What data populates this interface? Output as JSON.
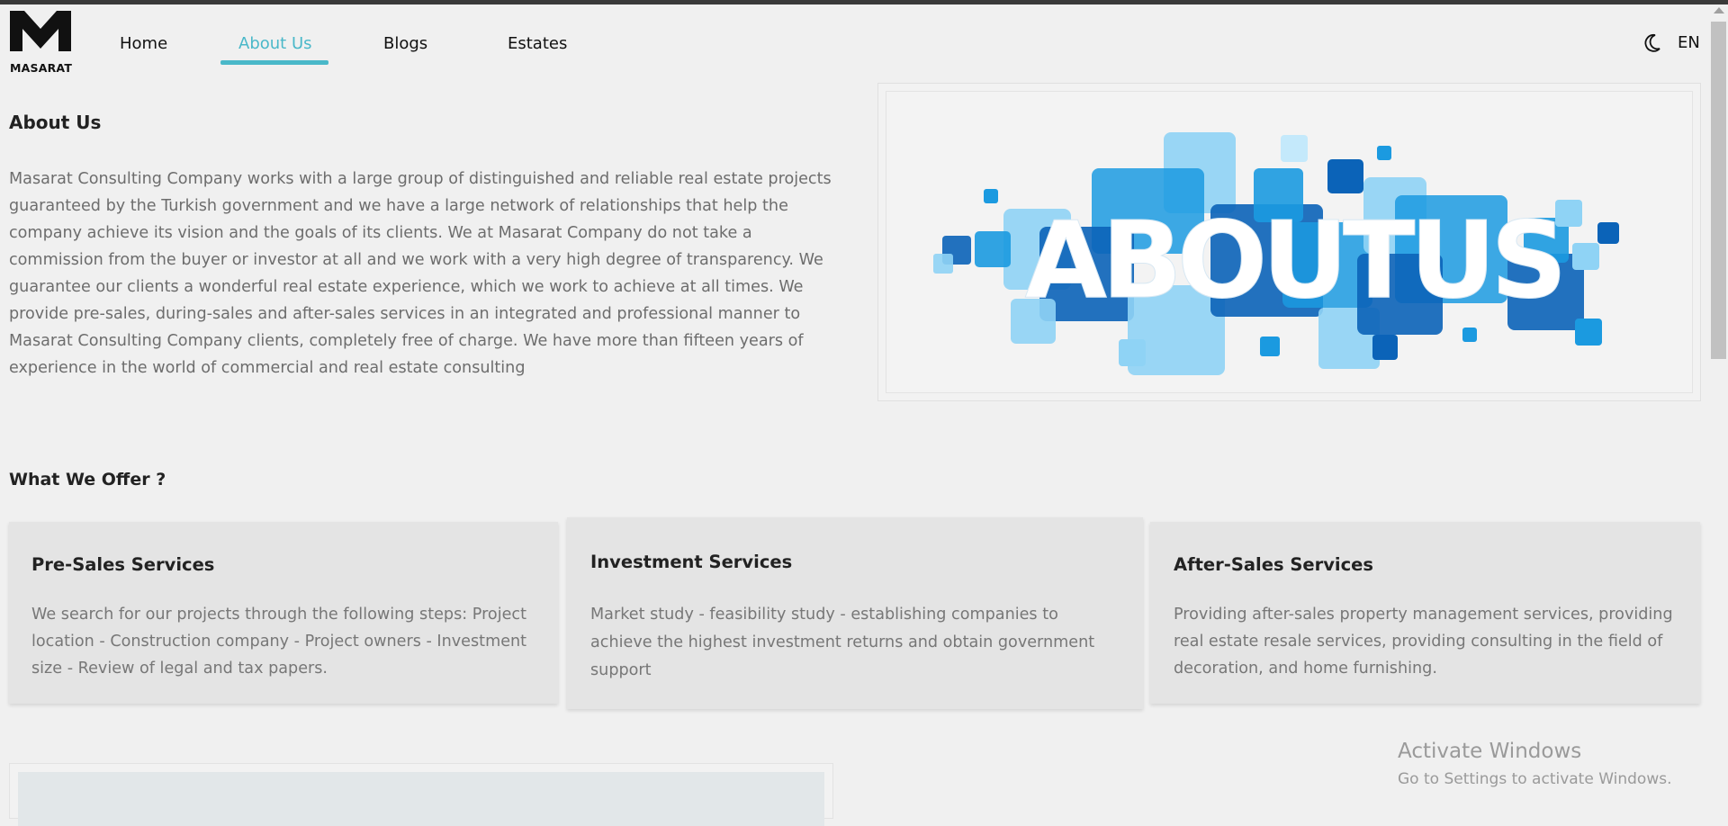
{
  "brand": {
    "logo_text": "MASARAT"
  },
  "nav": {
    "items": [
      {
        "label": "Home"
      },
      {
        "label": "About Us",
        "active": true
      },
      {
        "label": "Blogs"
      },
      {
        "label": "Estates"
      }
    ],
    "theme_toggle_icon": "moon-icon",
    "language": "EN"
  },
  "colors": {
    "accent": "#4ab8c9",
    "background": "#f0f0f0",
    "card": "#e4e4e4"
  },
  "about": {
    "title": "About Us",
    "text": "Masarat Consulting Company works with a large group of distinguished and reliable real estate projects guaranteed by the Turkish government and we have a large network of relationships that help the company achieve its vision and the goals of its clients. We at Masarat Company do not take a commission from the buyer or investor at all and we work with a very high degree of transparency. We guarantee our clients a wonderful real estate experience, which we work to achieve at all times. We provide pre-sales, during-sales and after-sales services in an integrated and professional manner to Masarat Consulting Company clients, completely free of charge. We have more than fifteen years of experience in the world of commercial and real estate consulting",
    "image_text": "ABOUTUS"
  },
  "offer": {
    "title": "What We Offer ?",
    "cards": [
      {
        "title": "Pre-Sales Services",
        "text": "We search for our projects through the following steps: Project location - Construction company - Project owners - Investment size - Review of legal and tax papers."
      },
      {
        "title": "Investment Services",
        "text": "Market study - feasibility study - establishing companies to achieve the highest investment returns and obtain government support"
      },
      {
        "title": "After-Sales Services",
        "text": "Providing after-sales property management services, providing real estate resale services, providing consulting in the field of decoration, and home furnishing."
      }
    ]
  },
  "watermark": {
    "line1": "Activate Windows",
    "line2": "Go to Settings to activate Windows."
  }
}
